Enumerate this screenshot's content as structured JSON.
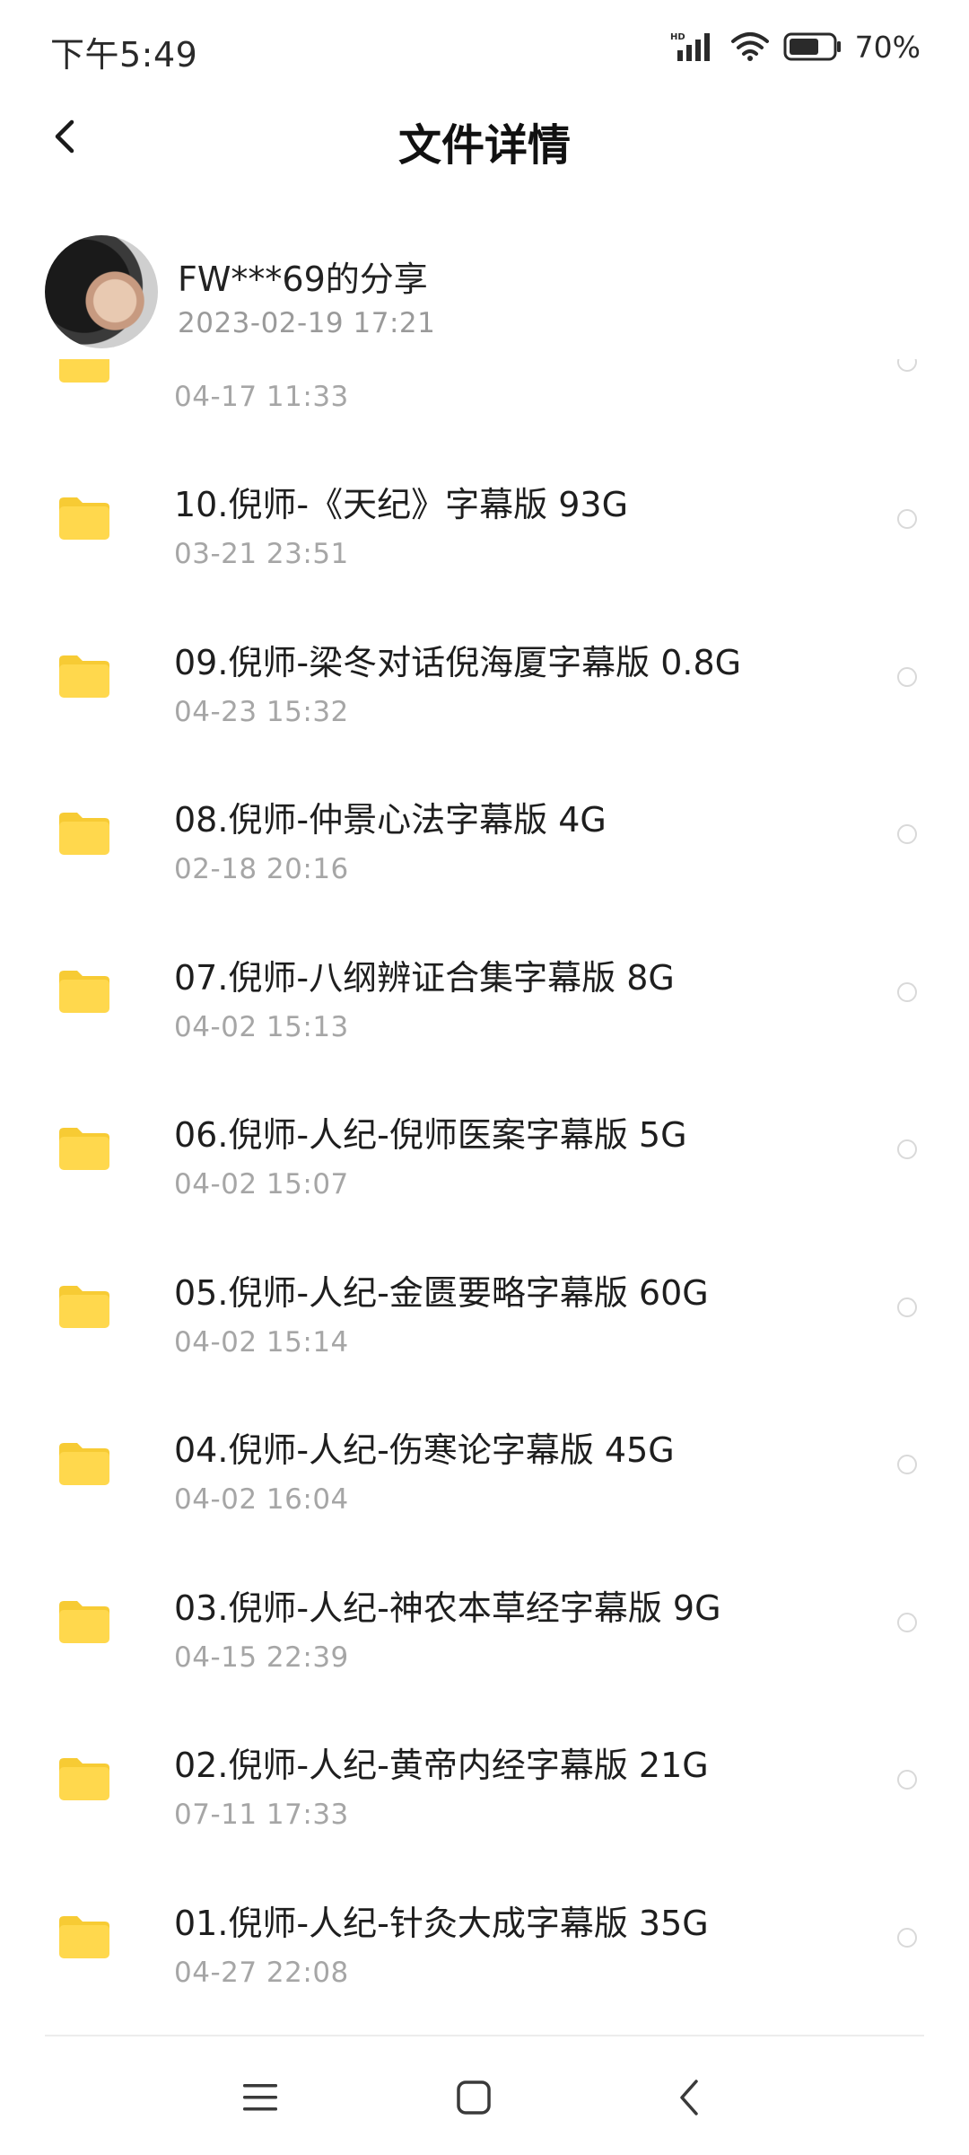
{
  "status_bar": {
    "time": "下午5:49",
    "network": "HD",
    "battery_percent": "70%",
    "battery_level": 0.7
  },
  "header": {
    "title": "文件详情"
  },
  "share": {
    "name": "FW***69的分享",
    "date": "2023-02-19  17:21"
  },
  "partial_item": {
    "date": "04-17  11:33"
  },
  "files": [
    {
      "name": "10.倪师-《天纪》字幕版 93G",
      "date": "03-21  23:51"
    },
    {
      "name": "09.倪师-梁冬对话倪海厦字幕版 0.8G",
      "date": "04-23  15:32"
    },
    {
      "name": "08.倪师-仲景心法字幕版 4G",
      "date": "02-18  20:16"
    },
    {
      "name": "07.倪师-八纲辨证合集字幕版 8G",
      "date": "04-02  15:13"
    },
    {
      "name": "06.倪师-人纪-倪师医案字幕版 5G",
      "date": "04-02  15:07"
    },
    {
      "name": "05.倪师-人纪-金匮要略字幕版  60G",
      "date": "04-02  15:14"
    },
    {
      "name": "04.倪师-人纪-伤寒论字幕版  45G",
      "date": "04-02  16:04"
    },
    {
      "name": "03.倪师-人纪-神农本草经字幕版 9G",
      "date": "04-15  22:39"
    },
    {
      "name": "02.倪师-人纪-黄帝内经字幕版  21G",
      "date": "07-11  17:33"
    },
    {
      "name": "01.倪师-人纪-针灸大成字幕版  35G",
      "date": "04-27  22:08"
    }
  ],
  "colors": {
    "folder": "#FFD84D",
    "folder_tab": "#F7CB34",
    "secondary_text": "#A6A6A6"
  }
}
